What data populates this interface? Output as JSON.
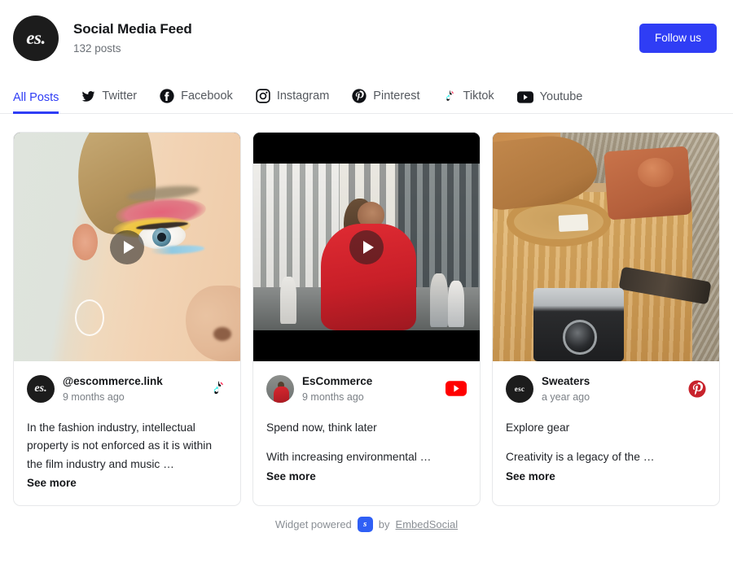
{
  "header": {
    "avatar_text": "es.",
    "title": "Social Media Feed",
    "subtitle": "132 posts",
    "follow_label": "Follow us"
  },
  "tabs": [
    {
      "label": "All Posts",
      "icon": "none",
      "active": true
    },
    {
      "label": "Twitter",
      "icon": "twitter-icon",
      "active": false
    },
    {
      "label": "Facebook",
      "icon": "facebook-icon",
      "active": false
    },
    {
      "label": "Instagram",
      "icon": "instagram-icon",
      "active": false
    },
    {
      "label": "Pinterest",
      "icon": "pinterest-icon",
      "active": false
    },
    {
      "label": "Tiktok",
      "icon": "tiktok-icon",
      "active": false
    },
    {
      "label": "Youtube",
      "icon": "youtube-icon",
      "active": false
    }
  ],
  "cards": [
    {
      "avatar_text": "es.",
      "author": "@escommerce.link",
      "time": "9 months ago",
      "platform": "tiktok-icon",
      "text": "In the fashion industry, intellectual property is not enforced as it is within the film industry and music …",
      "text_second": "",
      "see_more": "See more",
      "has_play": true,
      "media_alt": "close-up of a face with red and yellow eye makeup"
    },
    {
      "avatar_text": "",
      "author": "EsCommerce",
      "time": "9 months ago",
      "platform": "youtube-icon",
      "text": "Spend now, think later",
      "text_second": "With increasing environmental …",
      "see_more": "See more",
      "has_play": true,
      "media_alt": "woman in a red coat walking on a city street"
    },
    {
      "avatar_text": "esc",
      "author": "Sweaters",
      "time": "a year ago",
      "platform": "pinterest-icon",
      "text": "Explore gear",
      "text_second": "Creativity is a legacy of the …",
      "see_more": "See more",
      "has_play": false,
      "media_alt": "tan knit sweater flat lay with a vintage camera"
    }
  ],
  "footer": {
    "prefix": "Widget powered",
    "badge_text": "s",
    "middle": "by",
    "link": "EmbedSocial"
  },
  "colors": {
    "accent_blue": "#2f3df5",
    "youtube_red": "#ff0000",
    "pinterest_red": "#c8232c",
    "footer_badge_blue": "#2f5ff5",
    "text_dark": "#15171a",
    "text_muted": "#7b8086"
  }
}
